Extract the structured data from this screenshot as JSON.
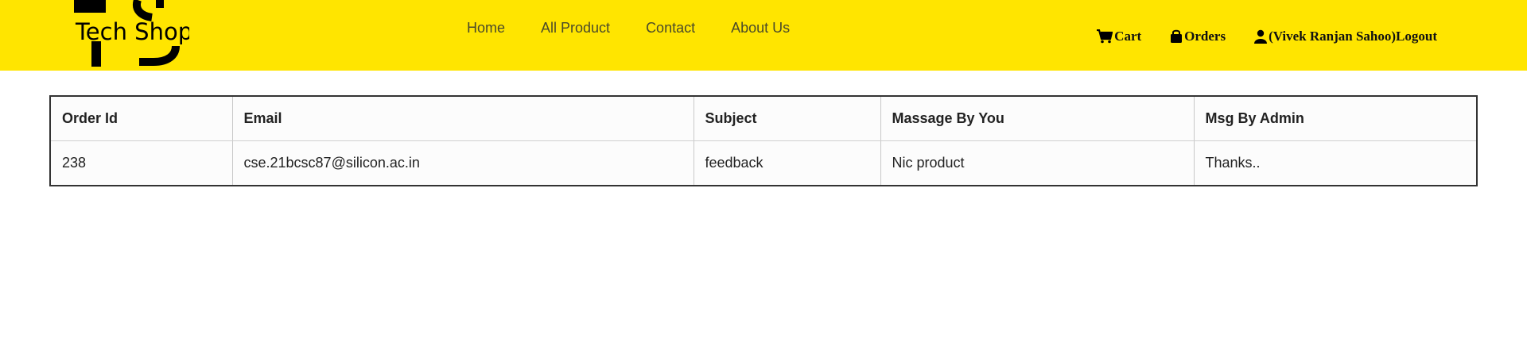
{
  "brand": {
    "logo_text": "Tech Shop",
    "logo_monogram": "TS",
    "bg_color": "#ffe500"
  },
  "nav": {
    "links": [
      "Home",
      "All Product",
      "Contact",
      "About Us"
    ]
  },
  "account": {
    "cart_label": "Cart",
    "cart_icon": "cart-icon",
    "orders_label": "Orders",
    "orders_icon": "shopping-bag-icon",
    "user_label": "(Vivek Ranjan Sahoo)Logout",
    "user_icon": "user-icon"
  },
  "messages_table": {
    "headers": [
      "Order Id",
      "Email",
      "Subject",
      "Massage By You",
      "Msg By Admin"
    ],
    "rows": [
      [
        "238",
        "cse.21bcsc87@silicon.ac.in",
        "feedback",
        "Nic product",
        "Thanks.."
      ]
    ]
  }
}
